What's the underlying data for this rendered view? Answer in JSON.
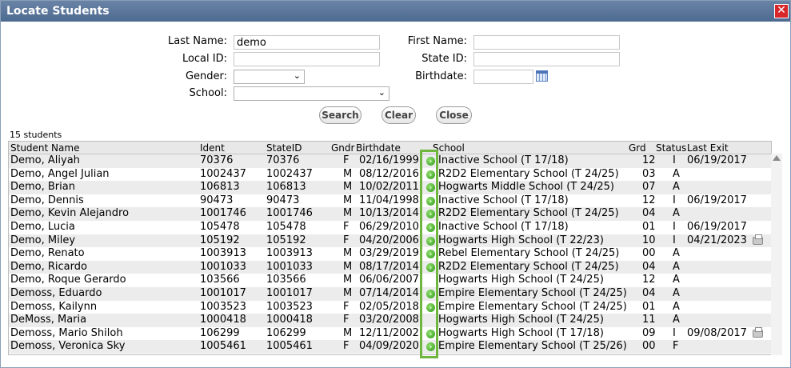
{
  "window": {
    "title": "Locate Students",
    "close_glyph": "✕"
  },
  "form": {
    "last_name_label": "Last Name:",
    "last_name_value": "demo",
    "first_name_label": "First Name:",
    "first_name_value": "",
    "local_id_label": "Local ID:",
    "local_id_value": "",
    "state_id_label": "State ID:",
    "state_id_value": "",
    "gender_label": "Gender:",
    "gender_value": "",
    "birthdate_label": "Birthdate:",
    "birthdate_value": "",
    "school_label": "School:",
    "school_value": ""
  },
  "buttons": {
    "search": "Search",
    "clear": "Clear",
    "close": "Close"
  },
  "results": {
    "count_text": "15 students",
    "columns": {
      "student_name": "Student Name",
      "ident": "Ident",
      "state_id": "StateID",
      "gndr": "Gndr",
      "birthdate": "Birthdate",
      "school": "School",
      "grd": "Grd",
      "status": "Status",
      "last_exit": "Last Exit"
    },
    "rows": [
      {
        "name": "Demo, Aliyah",
        "ident": "70376",
        "state_id": "70376",
        "gndr": "F",
        "birthdate": "02/16/1999",
        "go": true,
        "school": "Inactive School (T 17/18)",
        "grd": "12",
        "status": "I",
        "last_exit": "06/19/2017",
        "print": false
      },
      {
        "name": "Demo, Angel Julian",
        "ident": "1002437",
        "state_id": "1002437",
        "gndr": "M",
        "birthdate": "08/12/2016",
        "go": true,
        "school": "R2D2 Elementary School (T 24/25)",
        "grd": "03",
        "status": "A",
        "last_exit": "",
        "print": false
      },
      {
        "name": "Demo, Brian",
        "ident": "106813",
        "state_id": "106813",
        "gndr": "M",
        "birthdate": "10/02/2011",
        "go": true,
        "school": "Hogwarts Middle School (T 24/25)",
        "grd": "07",
        "status": "A",
        "last_exit": "",
        "print": false
      },
      {
        "name": "Demo, Dennis",
        "ident": "90473",
        "state_id": "90473",
        "gndr": "M",
        "birthdate": "11/04/1998",
        "go": true,
        "school": "Inactive School (T 17/18)",
        "grd": "12",
        "status": "I",
        "last_exit": "06/19/2017",
        "print": false
      },
      {
        "name": "Demo, Kevin Alejandro",
        "ident": "1001746",
        "state_id": "1001746",
        "gndr": "M",
        "birthdate": "10/13/2014",
        "go": true,
        "school": "R2D2 Elementary School (T 24/25)",
        "grd": "04",
        "status": "A",
        "last_exit": "",
        "print": false
      },
      {
        "name": "Demo, Lucia",
        "ident": "105478",
        "state_id": "105478",
        "gndr": "F",
        "birthdate": "06/29/2010",
        "go": true,
        "school": "Inactive School (T 17/18)",
        "grd": "01",
        "status": "I",
        "last_exit": "06/19/2017",
        "print": false
      },
      {
        "name": "Demo, Miley",
        "ident": "105192",
        "state_id": "105192",
        "gndr": "F",
        "birthdate": "04/20/2006",
        "go": true,
        "school": "Hogwarts High School (T 22/23)",
        "grd": "10",
        "status": "I",
        "last_exit": "04/21/2023",
        "print": true
      },
      {
        "name": "Demo, Renato",
        "ident": "1003913",
        "state_id": "1003913",
        "gndr": "M",
        "birthdate": "03/29/2019",
        "go": true,
        "school": "Rebel Elementary School (T 24/25)",
        "grd": "00",
        "status": "A",
        "last_exit": "",
        "print": false
      },
      {
        "name": "Demo, Ricardo",
        "ident": "1001033",
        "state_id": "1001033",
        "gndr": "M",
        "birthdate": "08/17/2014",
        "go": true,
        "school": "R2D2 Elementary School (T 24/25)",
        "grd": "04",
        "status": "A",
        "last_exit": "",
        "print": false
      },
      {
        "name": "Demo, Roque Gerardo",
        "ident": "103566",
        "state_id": "103566",
        "gndr": "M",
        "birthdate": "06/06/2007",
        "go": false,
        "school": "Hogwarts High School (T 24/25)",
        "grd": "12",
        "status": "A",
        "last_exit": "",
        "print": false
      },
      {
        "name": "Demoss, Eduardo",
        "ident": "1001017",
        "state_id": "1001017",
        "gndr": "M",
        "birthdate": "07/14/2014",
        "go": true,
        "school": "Empire Elementary School (T 24/25)",
        "grd": "04",
        "status": "A",
        "last_exit": "",
        "print": false
      },
      {
        "name": "Demoss, Kailynn",
        "ident": "1003523",
        "state_id": "1003523",
        "gndr": "F",
        "birthdate": "02/05/2018",
        "go": true,
        "school": "Empire Elementary School (T 24/25)",
        "grd": "01",
        "status": "A",
        "last_exit": "",
        "print": false
      },
      {
        "name": "DeMoss, Maria",
        "ident": "1000418",
        "state_id": "1000418",
        "gndr": "F",
        "birthdate": "03/20/2008",
        "go": false,
        "school": "Hogwarts High School (T 24/25)",
        "grd": "11",
        "status": "A",
        "last_exit": "",
        "print": false
      },
      {
        "name": "Demoss, Mario Shiloh",
        "ident": "106299",
        "state_id": "106299",
        "gndr": "M",
        "birthdate": "12/11/2002",
        "go": true,
        "school": "Hogwarts High School (T 17/18)",
        "grd": "09",
        "status": "I",
        "last_exit": "09/08/2017",
        "print": true
      },
      {
        "name": "Demoss, Veronica Sky",
        "ident": "1005461",
        "state_id": "1005461",
        "gndr": "F",
        "birthdate": "04/09/2020",
        "go": true,
        "school": "Empire Elementary School (T 25/26)",
        "grd": "00",
        "status": "F",
        "last_exit": "",
        "print": false
      }
    ]
  },
  "icons": {
    "go": "go-arrow-icon",
    "print": "printer-icon",
    "calendar": "calendar-icon"
  },
  "colors": {
    "titlebar": "#5a7699",
    "highlight": "#6fb63f",
    "go": "#3aa82a",
    "close": "#d8262a"
  }
}
